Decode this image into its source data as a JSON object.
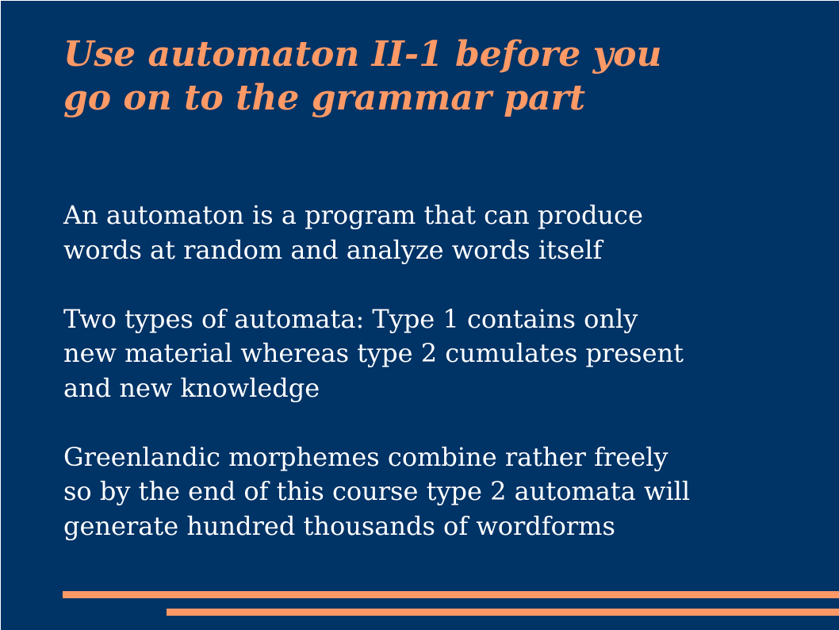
{
  "slide": {
    "title_lines": [
      "Use automaton II-1 before you",
      "go on to the grammar part"
    ],
    "paragraphs": [
      [
        "An automaton is a program that can produce",
        "words at random and analyze words itself"
      ],
      [
        "Two types of automata: Type 1 contains only",
        "new material whereas type 2 cumulates present",
        "and new knowledge"
      ],
      [
        "Greenlandic morphemes combine rather freely",
        "so by the end of this course type 2 automata will",
        "generate hundred thousands of wordforms"
      ]
    ]
  },
  "colors": {
    "background": "#003366",
    "accent": "#ff9966",
    "text": "#ffffff"
  }
}
